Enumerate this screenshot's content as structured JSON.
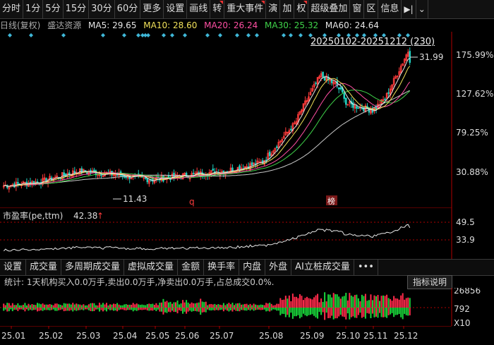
{
  "toolbar": {
    "items": [
      "分时",
      "1分",
      "5分",
      "15分",
      "30分",
      "60分",
      "更多",
      "设置",
      "画线",
      "转",
      "重大事件",
      "演",
      "加",
      "权",
      "超级叠加",
      "窗",
      "区",
      "信息"
    ],
    "flagged": [
      9,
      10,
      13
    ],
    "icons": [
      "play-icon",
      "chevron-down-icon"
    ]
  },
  "info": {
    "period": "日线(复权)",
    "stock": "盛达资源",
    "ma5": "MA5: 29.65",
    "ma10": "MA10: 28.60",
    "ma20": "MA20: 26.24",
    "ma30": "MA30: 25.32",
    "ma60": "MA60: 24.64"
  },
  "colors": {
    "ma5": "#e6e6e6",
    "ma10": "#f2e25a",
    "ma20": "#ff4fa3",
    "ma30": "#3fd44a",
    "ma60": "#c8c8c8",
    "up": "#ff3b3b",
    "down": "#20d0c0",
    "vol_up": "#ff2a4a",
    "vol_down": "#19d43a",
    "marker": "#3fb7d8"
  },
  "range_label": "20250102-20251212 (230)",
  "main_chart": {
    "price_axis": [
      "175.99%",
      "127.62%",
      "79.25%",
      "30.88%"
    ],
    "high_label": "31.99",
    "low_label": "11.43",
    "event_q": "q",
    "event_bang": "榜"
  },
  "pe": {
    "label": "市盈率(pe,ttm)",
    "value": "42.38",
    "axis": [
      "49.5",
      "33.9"
    ]
  },
  "tabs": [
    "设置",
    "成交量",
    "多周期成交量",
    "虚拟成交量",
    "金额",
    "换手率",
    "内盘",
    "外盘",
    "AI立桩成交量",
    "•••"
  ],
  "stat": "统计: 1天机构买入0.0万手,卖出0.0万手,净卖出0.0万手,占总成交0.0%.",
  "indicator_button": "指标说明",
  "volume": {
    "axis": [
      "26856",
      "792",
      "X10"
    ]
  },
  "x_axis": [
    "25.01",
    "25.02",
    "25.03",
    "25.04",
    "25.05",
    "25.06",
    "25.07",
    "25.08",
    "25.09",
    "25.10",
    "25.11",
    "25.12"
  ],
  "chart_data": {
    "type": "line",
    "x": [
      "25.01",
      "25.02",
      "25.03",
      "25.04",
      "25.05",
      "25.06",
      "25.07",
      "25.08",
      "25.09",
      "25.10",
      "25.11",
      "25.12"
    ],
    "series": [
      {
        "name": "MA5",
        "values": [
          12.9,
          13.5,
          15.1,
          14.6,
          13.8,
          14.5,
          15.1,
          16.4,
          23.0,
          25.6,
          24.2,
          29.65
        ]
      },
      {
        "name": "MA60",
        "values": [
          12.9,
          13.0,
          13.6,
          14.0,
          13.9,
          14.1,
          14.5,
          15.2,
          17.5,
          20.5,
          22.3,
          24.64
        ]
      }
    ],
    "y_max_label": "31.99",
    "y_min_label": "11.43"
  }
}
